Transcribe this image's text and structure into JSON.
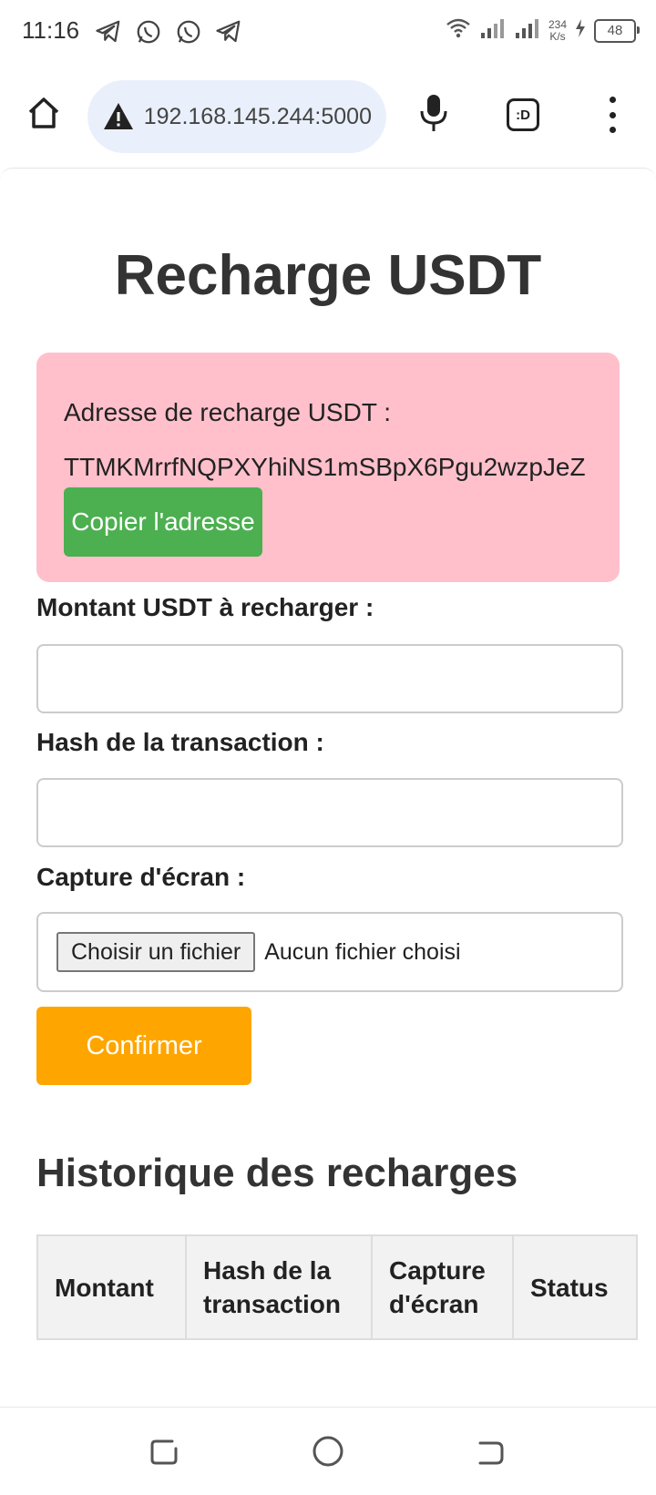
{
  "status_bar": {
    "time": "11:16",
    "speed_value": "234",
    "speed_unit": "K/s",
    "battery": "48"
  },
  "browser": {
    "url": "192.168.145.244:5000",
    "tab_label": ":D"
  },
  "page": {
    "title": "Recharge USDT",
    "address_box": {
      "label": "Adresse de recharge USDT :",
      "address": "TTMKMrrfNQPXYhiNS1mSBpX6Pgu2wzpJeZ",
      "copy_button": "Copier l'adresse"
    },
    "form": {
      "amount_label": "Montant USDT à recharger :",
      "amount_value": "",
      "hash_label": "Hash de la transaction :",
      "hash_value": "",
      "screenshot_label": "Capture d'écran :",
      "file_button": "Choisir un fichier",
      "file_status": "Aucun fichier choisi",
      "confirm_button": "Confirmer"
    },
    "history": {
      "title": "Historique des recharges",
      "columns": [
        "Montant",
        "Hash de la transaction",
        "Capture d'écran",
        "Status"
      ]
    }
  },
  "colors": {
    "address_box_bg": "#ffc0cb",
    "copy_button_bg": "#4caf50",
    "confirm_button_bg": "#ffa500",
    "url_bar_bg": "#eaf0fb"
  }
}
